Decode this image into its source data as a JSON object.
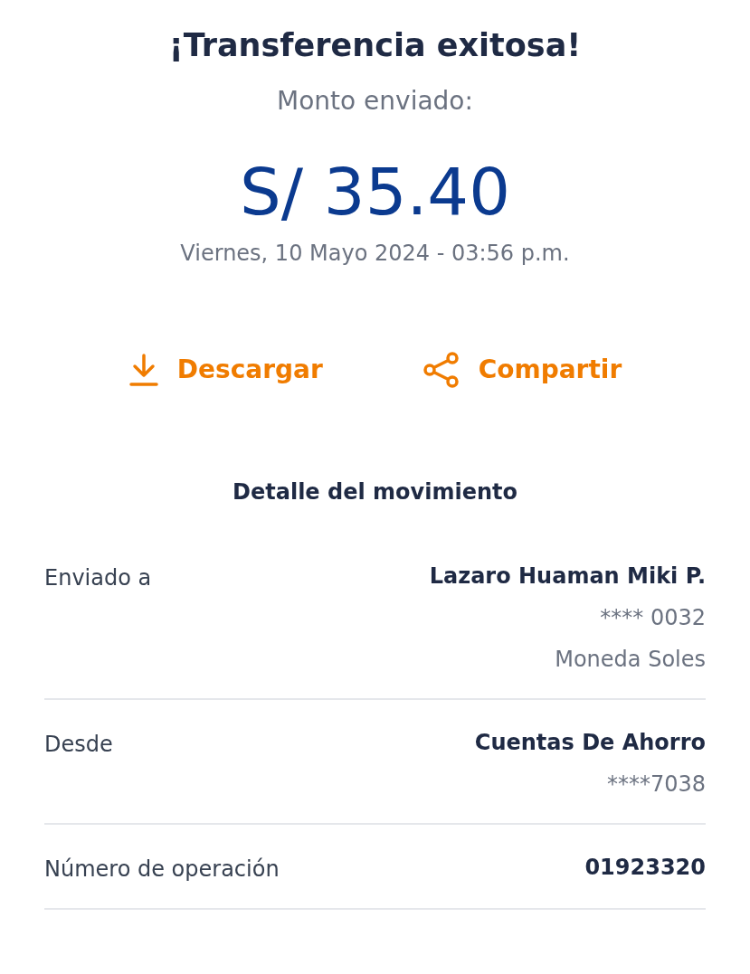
{
  "title": "¡Transferencia exitosa!",
  "amount_label": "Monto enviado:",
  "amount": "S/ 35.40",
  "date": "Viernes, 10 Mayo 2024 - 03:56 p.m.",
  "actions": [
    {
      "kind": "download",
      "label": "Descargar"
    },
    {
      "kind": "share",
      "label": "Compartir"
    }
  ],
  "section_title": "Detalle del movimiento",
  "details": [
    {
      "label": "Enviado a",
      "value": "Lazaro Huaman Miki P.",
      "lines": [
        "**** 0032",
        "Moneda Soles"
      ]
    },
    {
      "label": "Desde",
      "value": "Cuentas De Ahorro",
      "lines": [
        "****7038"
      ]
    },
    {
      "label": "Número de operación",
      "value": "01923320"
    }
  ]
}
